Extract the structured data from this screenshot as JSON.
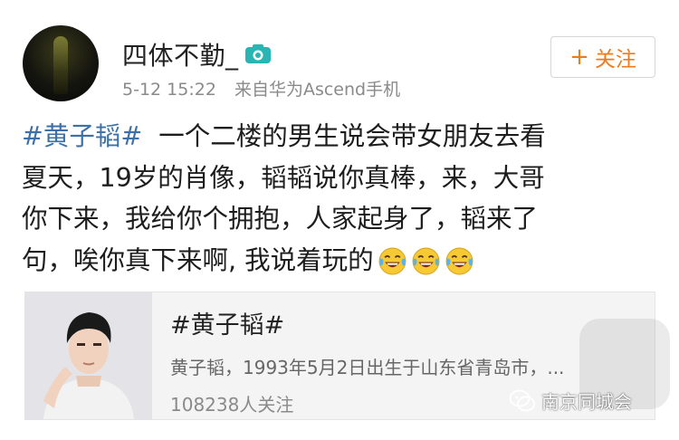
{
  "user": {
    "name": "四体不勤_",
    "time": "5-12 15:22",
    "source": "来自华为Ascend手机"
  },
  "follow_button": {
    "plus": "+",
    "label": "关注"
  },
  "post": {
    "hashtag": "#黄子韬#",
    "line1_rest": "一个二楼的男生说会带女朋友去看",
    "line2": "夏天，19岁的肖像，韬韬说你真棒，来，大哥",
    "line3": "你下来，我给你个拥抱，人家起身了，韬来了",
    "line4": "句，唉你真下来啊, 我说着玩的",
    "emojis": [
      "laughing-tears-emoji",
      "laughing-tears-emoji",
      "laughing-tears-emoji"
    ]
  },
  "topic_card": {
    "title": "#黄子韬#",
    "description": "黄子韬，1993年5月2日出生于山东省青岛市，...",
    "followers": "108238人关注"
  },
  "watermark": {
    "text": "南京同城会",
    "icon": "wechat-icon"
  },
  "colors": {
    "hashtag": "#3c70a8",
    "follow": "#f07a1a",
    "camera_badge": "#2ab5b5"
  }
}
